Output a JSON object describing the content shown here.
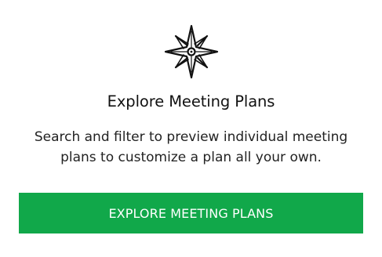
{
  "card": {
    "icon": "compass-rose-icon",
    "title": "Explore Meeting Plans",
    "description": "Search and filter to preview individual meeting plans to customize a plan all your own.",
    "button_label": "EXPLORE MEETING PLANS"
  },
  "colors": {
    "accent": "#11a84a",
    "card_background": "#ffffff",
    "page_background": "#f2f2f2",
    "title_text": "#111111"
  }
}
